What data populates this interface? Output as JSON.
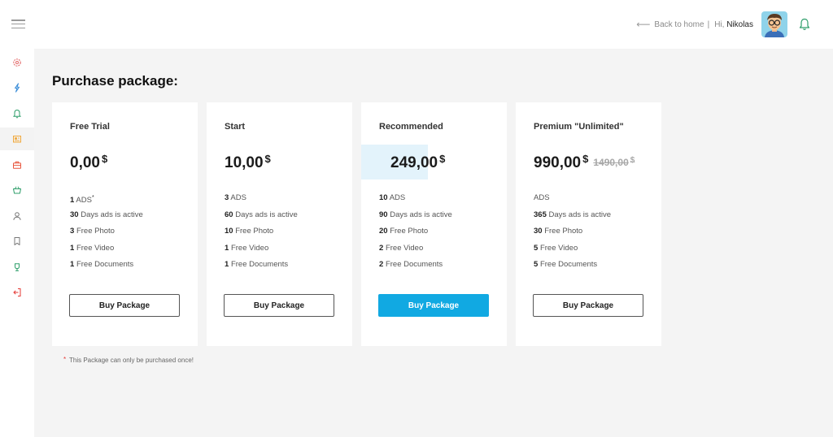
{
  "header": {
    "back_label": "Back to home",
    "separator": "|",
    "greeting": "Hi,",
    "user_name": "Nikolas"
  },
  "sidebar": {
    "icons": [
      "gear-icon",
      "flash-icon",
      "bell-icon",
      "ads-icon",
      "briefcase-icon",
      "basket-icon",
      "user-icon",
      "bookmark-icon",
      "cup-icon",
      "logout-icon"
    ],
    "active_index": 3
  },
  "page": {
    "title": "Purchase package:"
  },
  "packages": [
    {
      "name": "Free Trial",
      "price": "0,00",
      "currency": "$",
      "features": [
        {
          "value": "1",
          "label": "ADS",
          "mark": "*"
        },
        {
          "value": "30",
          "label": "Days ads is active"
        },
        {
          "value": "3",
          "label": "Free Photo"
        },
        {
          "value": "1",
          "label": "Free Video"
        },
        {
          "value": "1",
          "label": "Free Documents"
        }
      ],
      "button": "Buy Package"
    },
    {
      "name": "Start",
      "price": "10,00",
      "currency": "$",
      "features": [
        {
          "value": "3",
          "label": "ADS"
        },
        {
          "value": "60",
          "label": "Days ads is active"
        },
        {
          "value": "10",
          "label": "Free Photo"
        },
        {
          "value": "1",
          "label": "Free Video"
        },
        {
          "value": "1",
          "label": "Free Documents"
        }
      ],
      "button": "Buy Package"
    },
    {
      "name": "Recommended",
      "price": "249,00",
      "currency": "$",
      "features": [
        {
          "value": "10",
          "label": "ADS"
        },
        {
          "value": "90",
          "label": "Days ads is active"
        },
        {
          "value": "20",
          "label": "Free Photo"
        },
        {
          "value": "2",
          "label": "Free Video"
        },
        {
          "value": "2",
          "label": "Free Documents"
        }
      ],
      "button": "Buy Package"
    },
    {
      "name": "Premium \"Unlimited\"",
      "price": "990,00",
      "currency": "$",
      "old_price": "1490,00",
      "old_currency": "$",
      "features": [
        {
          "value": "",
          "label": "ADS"
        },
        {
          "value": "365",
          "label": "Days ads is active"
        },
        {
          "value": "30",
          "label": "Free Photo"
        },
        {
          "value": "5",
          "label": "Free Video"
        },
        {
          "value": "5",
          "label": "Free Documents"
        }
      ],
      "button": "Buy Package"
    }
  ],
  "footnote": {
    "mark": "*",
    "text": "This Package can only be purchased once!"
  },
  "colors": {
    "accent": "#11a9e2",
    "highlight": "#e3f3fb",
    "mark": "#e53935",
    "bell": "#2e9e6a"
  }
}
